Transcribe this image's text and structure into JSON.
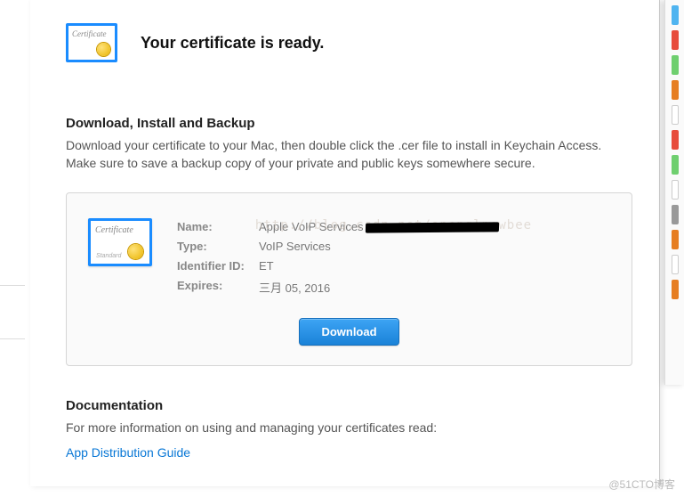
{
  "header": {
    "title": "Your certificate is ready."
  },
  "download_section": {
    "title": "Download, Install and Backup",
    "text": "Download your certificate to your Mac, then double click the .cer file to install in Keychain Access. Make sure to save a backup copy of your private and public keys somewhere secure."
  },
  "certificate": {
    "name_label": "Name:",
    "name_value": "Apple VoIP Services",
    "type_label": "Type:",
    "type_value": "VoIP Services",
    "identifier_label": "Identifier ID:",
    "identifier_value": "ET",
    "expires_label": "Expires:",
    "expires_value": "三月 05, 2016",
    "download_button": "Download",
    "icon_ribbon": "Standard"
  },
  "documentation": {
    "title": "Documentation",
    "text": "For more information on using and managing your certificates read:",
    "link": "App Distribution Guide"
  },
  "overlay_watermark": "http://blog.csdn.net/openglnewbee",
  "corner_watermark": "@51CTO博客"
}
